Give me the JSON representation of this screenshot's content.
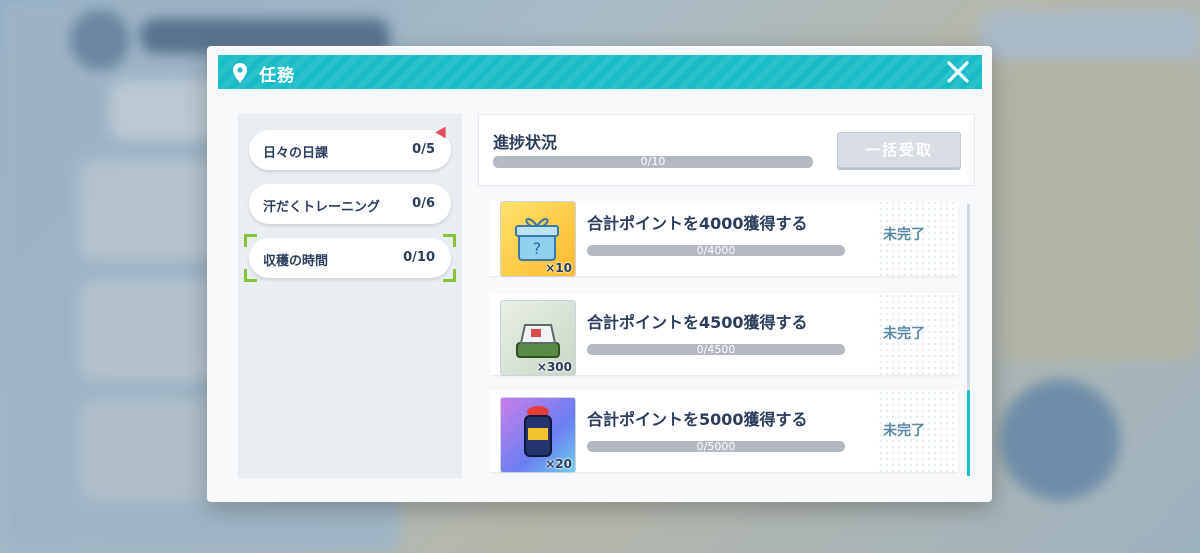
{
  "window": {
    "title": "任務",
    "icons": {
      "location": "map-pin-icon",
      "close": "close-icon"
    }
  },
  "sidebar": {
    "tabs": [
      {
        "label": "日々の日課",
        "count": "0/5",
        "has_alert": true
      },
      {
        "label": "汗だくトレーニング",
        "count": "0/6"
      },
      {
        "label": "収穫の時間",
        "count": "0/10",
        "selected": true
      }
    ]
  },
  "progress": {
    "title": "進捗状況",
    "bar_text": "0/10",
    "fraction": 0,
    "claim_all_label": "一括受取"
  },
  "missions": [
    {
      "title": "合計ポイントを4000獲得する",
      "progress_text": "0/4000",
      "fraction": 0,
      "reward_qty": "×10",
      "reward_icon": "gift-box-icon",
      "status": "未完了"
    },
    {
      "title": "合計ポイントを4500獲得する",
      "progress_text": "0/4500",
      "fraction": 0,
      "reward_qty": "×300",
      "reward_icon": "tent-icon",
      "status": "未完了"
    },
    {
      "title": "合計ポイントを5000獲得する",
      "progress_text": "0/5000",
      "fraction": 0,
      "reward_qty": "×20",
      "reward_icon": "battery-jar-icon",
      "status": "未完了"
    }
  ],
  "colors": {
    "accent": "#17bcc8",
    "text": "#2b3d5a",
    "status": "#5b88a4",
    "alert": "#e24b5b",
    "selection": "#86c23a"
  }
}
